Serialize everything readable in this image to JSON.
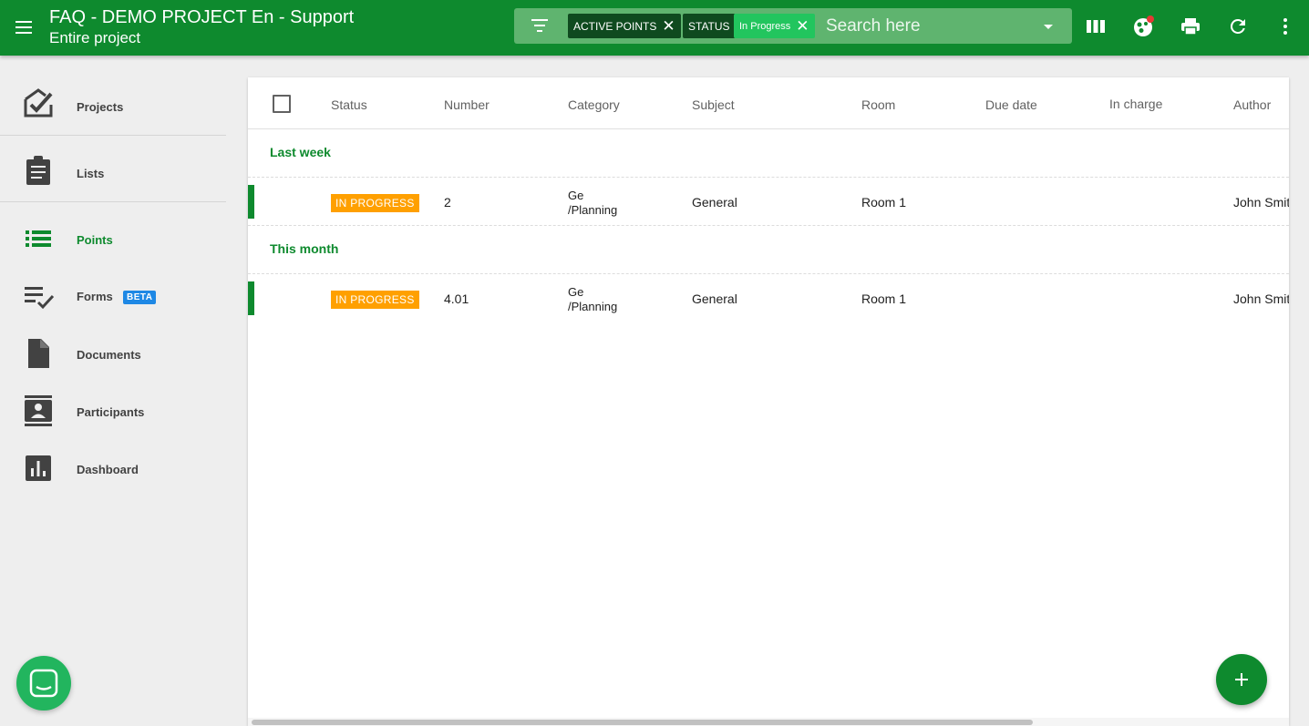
{
  "app": {
    "title": "FAQ - DEMO PROJECT En - Support",
    "subtitle": "Entire project"
  },
  "filters": {
    "chips": [
      {
        "label": "ACTIVE POINTS"
      },
      {
        "label": "STATUS"
      },
      {
        "label": "In Progress"
      }
    ],
    "search_placeholder": "Search here"
  },
  "toolbar_icons": [
    "columns-icon",
    "filter-balls-icon",
    "print-icon",
    "refresh-icon",
    "more-vert-icon"
  ],
  "sidebar": {
    "items": [
      {
        "label": "Projects",
        "icon": "projects-check-icon"
      },
      {
        "label": "Lists",
        "icon": "clipboard-icon"
      },
      {
        "label": "Points",
        "icon": "list-icon",
        "active": true
      },
      {
        "label": "Forms",
        "icon": "checklist-icon",
        "badge": "BETA"
      },
      {
        "label": "Documents",
        "icon": "document-icon"
      },
      {
        "label": "Participants",
        "icon": "contacts-icon"
      },
      {
        "label": "Dashboard",
        "icon": "bar-chart-icon"
      }
    ]
  },
  "table": {
    "columns": [
      "Status",
      "Number",
      "Category",
      "Subject",
      "Room",
      "Due date",
      "In charge",
      "Author"
    ],
    "groups": [
      {
        "label": "Last week",
        "rows": [
          {
            "status": "IN PROGRESS",
            "number": "2",
            "category_line1": "Ge",
            "category_line2": "/Planning",
            "subject": "General",
            "room": "Room 1",
            "due_date": "",
            "in_charge": "",
            "author": "John Smit"
          }
        ]
      },
      {
        "label": "This month",
        "rows": [
          {
            "status": "IN PROGRESS",
            "number": "4.01",
            "category_line1": "Ge",
            "category_line2": "/Planning",
            "subject": "General",
            "room": "Room 1",
            "due_date": "",
            "in_charge": "",
            "author": "John Smit"
          }
        ]
      }
    ]
  },
  "colors": {
    "brand": "#0e8a2e",
    "status_in_progress": "#ffa000",
    "beta_badge": "#1e88e5"
  }
}
